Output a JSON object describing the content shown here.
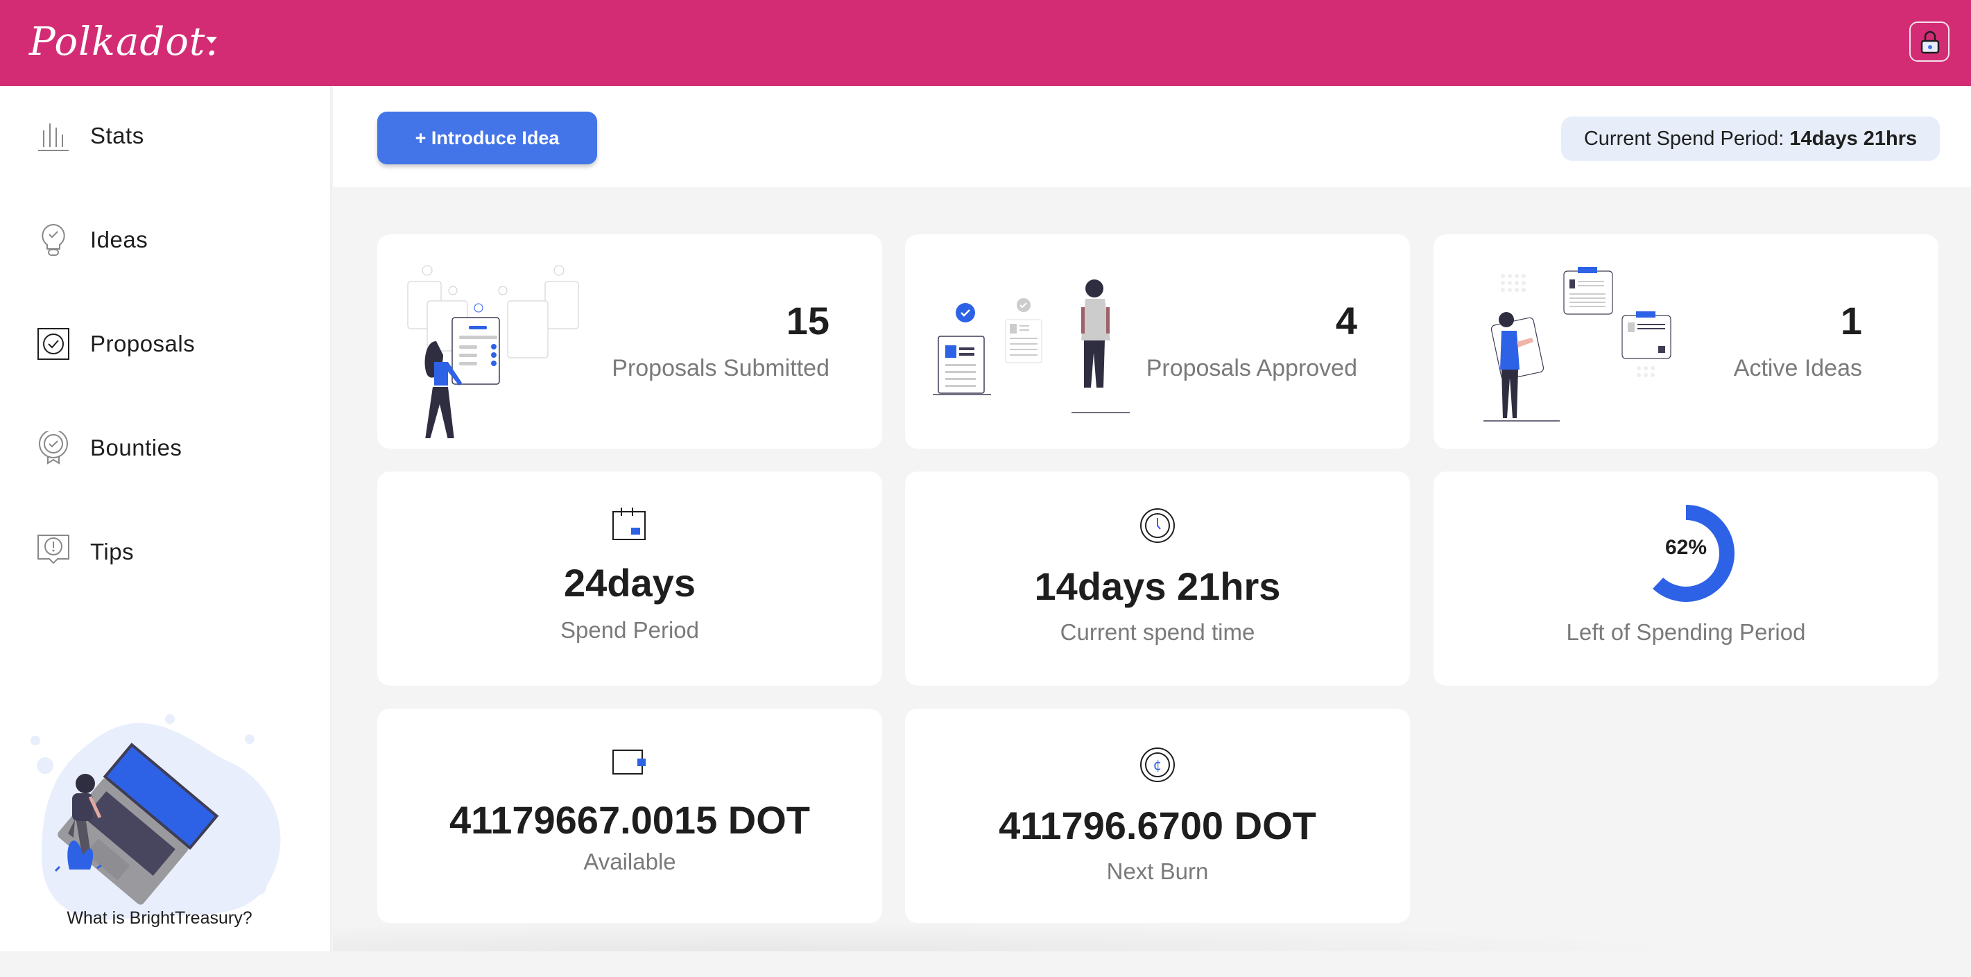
{
  "header": {
    "brand": "Polkadot.",
    "brand_color": "#d32c75",
    "lock_icon": "lock-icon"
  },
  "sidebar": {
    "items": [
      {
        "label": "Stats",
        "icon": "bar-chart-icon"
      },
      {
        "label": "Ideas",
        "icon": "lightbulb-icon"
      },
      {
        "label": "Proposals",
        "icon": "check-circle-icon"
      },
      {
        "label": "Bounties",
        "icon": "badge-icon"
      },
      {
        "label": "Tips",
        "icon": "alert-bubble-icon"
      }
    ],
    "help_link": "What is BrightTreasury?"
  },
  "topbar": {
    "introduce_button": "+ Introduce Idea",
    "spend_period_label": "Current Spend Period:",
    "spend_period_value": "14days 21hrs",
    "accent": "#4374e8"
  },
  "stats": {
    "proposals_submitted": {
      "value": "15",
      "label": "Proposals Submitted"
    },
    "proposals_approved": {
      "value": "4",
      "label": "Proposals Approved"
    },
    "active_ideas": {
      "value": "1",
      "label": "Active Ideas"
    },
    "spend_period": {
      "value": "24days",
      "label": "Spend Period",
      "icon": "calendar-icon"
    },
    "current_spend_time": {
      "value": "14days 21hrs",
      "label": "Current spend time",
      "icon": "clock-icon"
    },
    "left_of_period": {
      "percent": 62,
      "text": "62%",
      "label": "Left of Spending Period"
    },
    "available": {
      "value": "41179667.0015 DOT",
      "label": "Available",
      "icon": "wallet-icon"
    },
    "next_burn": {
      "value": "411796.6700 DOT",
      "label": "Next Burn",
      "icon": "coin-icon"
    }
  }
}
